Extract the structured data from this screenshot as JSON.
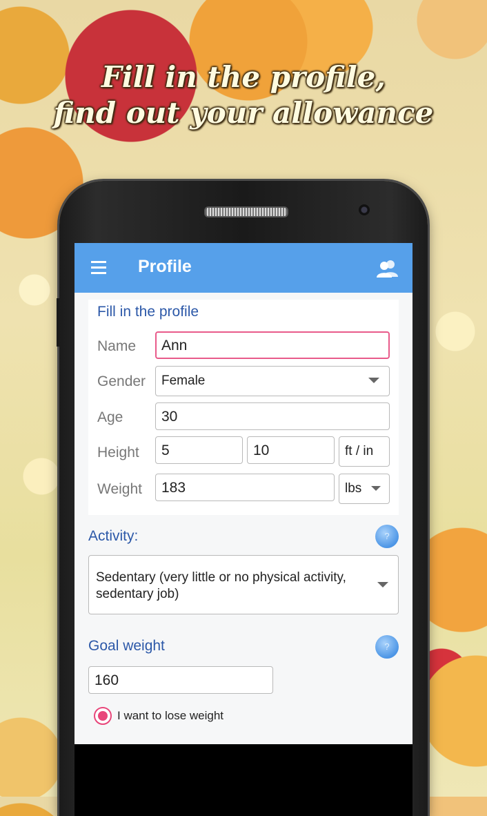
{
  "headline": {
    "line1": "Fill in the profile,",
    "line2": "find out your allowance"
  },
  "appbar": {
    "title": "Profile",
    "menu_icon": "hamburger-menu-icon",
    "right_icon": "people-icon"
  },
  "profile": {
    "section_title": "Fill in the profile",
    "name_label": "Name",
    "name_value": "Ann",
    "gender_label": "Gender",
    "gender_value": "Female",
    "age_label": "Age",
    "age_value": "30",
    "height_label": "Height",
    "height_ft": "5",
    "height_in": "10",
    "height_unit": "ft / in",
    "weight_label": "Weight",
    "weight_value": "183",
    "weight_unit": "lbs"
  },
  "activity": {
    "label": "Activity:",
    "help": "?",
    "value": "Sedentary (very little or no physical activity, sedentary job)"
  },
  "goal": {
    "label": "Goal weight",
    "help": "?",
    "value": "160",
    "radio_label": "I want to lose weight",
    "radio_selected": true
  },
  "colors": {
    "appbar": "#56a0ea",
    "accent_pink": "#e8467a",
    "section_blue": "#2c58a8"
  }
}
